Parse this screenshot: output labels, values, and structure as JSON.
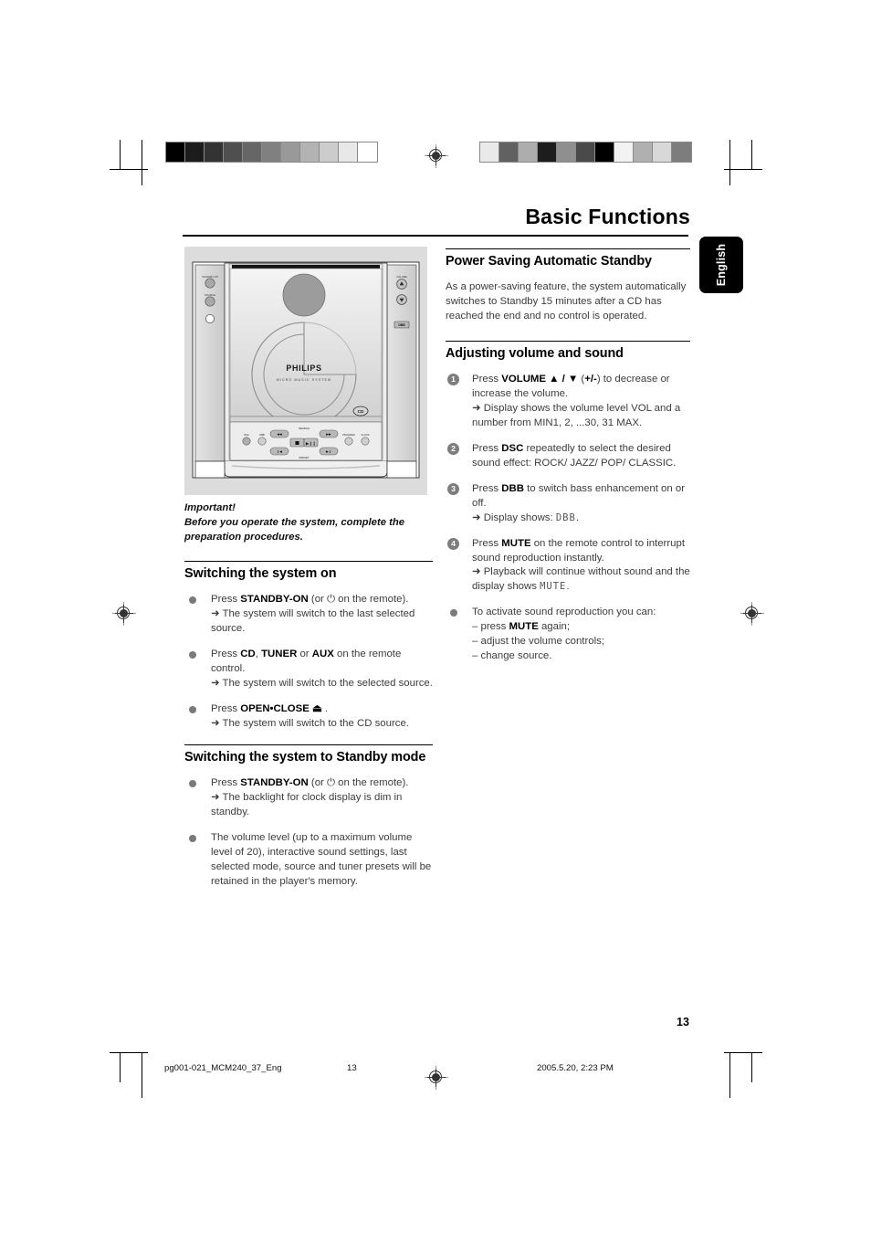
{
  "document": {
    "chapter_title": "Basic Functions",
    "language_tab": "English",
    "page_number": "13"
  },
  "footer": {
    "filename": "pg001-021_MCM240_37_Eng",
    "page": "13",
    "timestamp": "2005.5.20, 2:23 PM"
  },
  "illustration": {
    "caption": "philips-micro-music-system-front-view",
    "brand": "PHILIPS",
    "sub_brand": "MICRO MUSIC SYSTEM",
    "disc_label": "COMPACT DISC DIGITAL AUDIO"
  },
  "left_column": {
    "important_heading": "Important!",
    "important_body": "Before you operate the system, complete the preparation procedures.",
    "sections": [
      {
        "heading": "Switching the system on",
        "items": [
          {
            "marker": "bullet",
            "lines": [
              {
                "segments": [
                  {
                    "t": "Press ",
                    "b": false
                  },
                  {
                    "t": "STANDBY-ON",
                    "b": true
                  },
                  {
                    "t": " (or ⏻ on the remote).",
                    "b": false
                  }
                ]
              },
              {
                "segments": [
                  {
                    "t": "➜ The system will switch to the last selected source.",
                    "b": false
                  }
                ]
              }
            ]
          },
          {
            "marker": "bullet",
            "lines": [
              {
                "segments": [
                  {
                    "t": "Press ",
                    "b": false
                  },
                  {
                    "t": "CD",
                    "b": true
                  },
                  {
                    "t": ", ",
                    "b": false
                  },
                  {
                    "t": "TUNER",
                    "b": true
                  },
                  {
                    "t": " or ",
                    "b": false
                  },
                  {
                    "t": "AUX",
                    "b": true
                  },
                  {
                    "t": " on the remote control.",
                    "b": false
                  }
                ]
              },
              {
                "segments": [
                  {
                    "t": "➜ The system will switch to the selected source.",
                    "b": false
                  }
                ]
              }
            ]
          },
          {
            "marker": "bullet",
            "lines": [
              {
                "segments": [
                  {
                    "t": "Press ",
                    "b": false
                  },
                  {
                    "t": "OPEN•CLOSE ⏏",
                    "b": true
                  },
                  {
                    "t": " .",
                    "b": false
                  }
                ]
              },
              {
                "segments": [
                  {
                    "t": "➜ The system will switch to the CD source.",
                    "b": false
                  }
                ]
              }
            ]
          }
        ]
      },
      {
        "heading": "Switching the system to Standby mode",
        "items": [
          {
            "marker": "bullet",
            "lines": [
              {
                "segments": [
                  {
                    "t": "Press ",
                    "b": false
                  },
                  {
                    "t": "STANDBY-ON",
                    "b": true
                  },
                  {
                    "t": " (or ⏻ on the remote).",
                    "b": false
                  }
                ]
              },
              {
                "segments": [
                  {
                    "t": "➜ The backlight for clock display is dim in standby.",
                    "b": false
                  }
                ]
              }
            ]
          },
          {
            "marker": "bullet",
            "lines": [
              {
                "segments": [
                  {
                    "t": "The volume level (up to a maximum volume level of 20), interactive sound settings, last selected mode, source and tuner presets will be retained in the player's memory.",
                    "b": false
                  }
                ]
              }
            ]
          }
        ]
      }
    ]
  },
  "right_column": {
    "sections": [
      {
        "heading": "Power Saving Automatic Standby",
        "paragraph": "As a power-saving feature, the system automatically switches to Standby 15 minutes after a CD has reached the end and no control is operated.",
        "items": []
      },
      {
        "heading": "Adjusting volume and sound",
        "paragraph": "",
        "items": [
          {
            "marker": "1",
            "lines": [
              {
                "segments": [
                  {
                    "t": "Press ",
                    "b": false
                  },
                  {
                    "t": "VOLUME ▲ / ▼",
                    "b": true
                  },
                  {
                    "t": " (",
                    "b": false
                  },
                  {
                    "t": "+/-",
                    "b": true
                  },
                  {
                    "t": ") to decrease or increase the volume.",
                    "b": false
                  }
                ]
              },
              {
                "segments": [
                  {
                    "t": "➜ Display shows the volume level VOL and a number from MIN1, 2, ...30, 31 MAX.",
                    "b": false
                  }
                ]
              }
            ]
          },
          {
            "marker": "2",
            "lines": [
              {
                "segments": [
                  {
                    "t": "Press ",
                    "b": false
                  },
                  {
                    "t": "DSC",
                    "b": true
                  },
                  {
                    "t": " repeatedly to select the desired sound effect: ROCK/ JAZZ/ POP/ CLASSIC.",
                    "b": false
                  }
                ]
              }
            ]
          },
          {
            "marker": "3",
            "lines": [
              {
                "segments": [
                  {
                    "t": "Press ",
                    "b": false
                  },
                  {
                    "t": "DBB",
                    "b": true
                  },
                  {
                    "t": " to switch bass enhancement on or off.",
                    "b": false
                  }
                ]
              },
              {
                "segments": [
                  {
                    "t": "➜ Display shows: ",
                    "b": false
                  },
                  {
                    "t": "DBB",
                    "b": false,
                    "lcd": true
                  },
                  {
                    "t": ".",
                    "b": false
                  }
                ]
              }
            ]
          },
          {
            "marker": "4",
            "lines": [
              {
                "segments": [
                  {
                    "t": "Press ",
                    "b": false
                  },
                  {
                    "t": "MUTE",
                    "b": true
                  },
                  {
                    "t": " on the remote control to interrupt sound reproduction instantly.",
                    "b": false
                  }
                ]
              },
              {
                "segments": [
                  {
                    "t": "➜ Playback will continue without sound and the display shows ",
                    "b": false
                  },
                  {
                    "t": "MUTE",
                    "b": false,
                    "lcd": true
                  },
                  {
                    "t": ".",
                    "b": false
                  }
                ]
              }
            ]
          },
          {
            "marker": "bullet",
            "lines": [
              {
                "segments": [
                  {
                    "t": "To activate sound reproduction you can:",
                    "b": false
                  }
                ]
              },
              {
                "sub": true,
                "segments": [
                  {
                    "t": "–  press ",
                    "b": false
                  },
                  {
                    "t": "MUTE",
                    "b": true
                  },
                  {
                    "t": " again;",
                    "b": false
                  }
                ]
              },
              {
                "sub": true,
                "segments": [
                  {
                    "t": "–  adjust the volume controls;",
                    "b": false
                  }
                ]
              },
              {
                "sub": true,
                "segments": [
                  {
                    "t": "–  change source.",
                    "b": false
                  }
                ]
              }
            ]
          }
        ]
      }
    ]
  },
  "print_marks": {
    "gray_strip_left": [
      "#000000",
      "#1c1c1c",
      "#333333",
      "#4f4f4f",
      "#666666",
      "#808080",
      "#999999",
      "#b3b3b3",
      "#cccccc",
      "#e8e8e8",
      "#ffffff"
    ],
    "gray_strip_right": [
      "#e9e9e9",
      "#616161",
      "#adadad",
      "#1d1d1d",
      "#8f8f8f",
      "#4a4a4a",
      "#000000",
      "#f2f2f2",
      "#b0b0b0",
      "#d8d8d8",
      "#7d7d7d"
    ]
  }
}
